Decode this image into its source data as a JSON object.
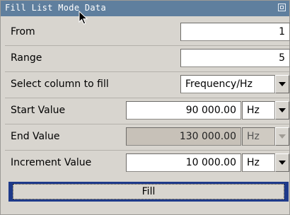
{
  "window": {
    "title": "Fill List Mode Data"
  },
  "rows": {
    "from": {
      "label": "From",
      "value": "1"
    },
    "range": {
      "label": "Range",
      "value": "5"
    },
    "column": {
      "label": "Select column to fill",
      "value": "Frequency/Hz"
    },
    "start": {
      "label": "Start Value",
      "value": "90 000.00",
      "unit": "Hz"
    },
    "end": {
      "label": "End Value",
      "value": "130 000.00",
      "unit": "Hz",
      "disabled": true
    },
    "increment": {
      "label": "Increment Value",
      "value": "10 000.00",
      "unit": "Hz"
    }
  },
  "actions": {
    "fill_label": "Fill"
  },
  "colors": {
    "titlebar": "#5f7f9e",
    "panel": "#d8d5cf",
    "button_frame": "#1e3a8a",
    "disabled_field": "#c7c1b8"
  },
  "icons": [
    "window-restore-icon",
    "mouse-cursor-icon",
    "dropdown-arrow-icon"
  ]
}
